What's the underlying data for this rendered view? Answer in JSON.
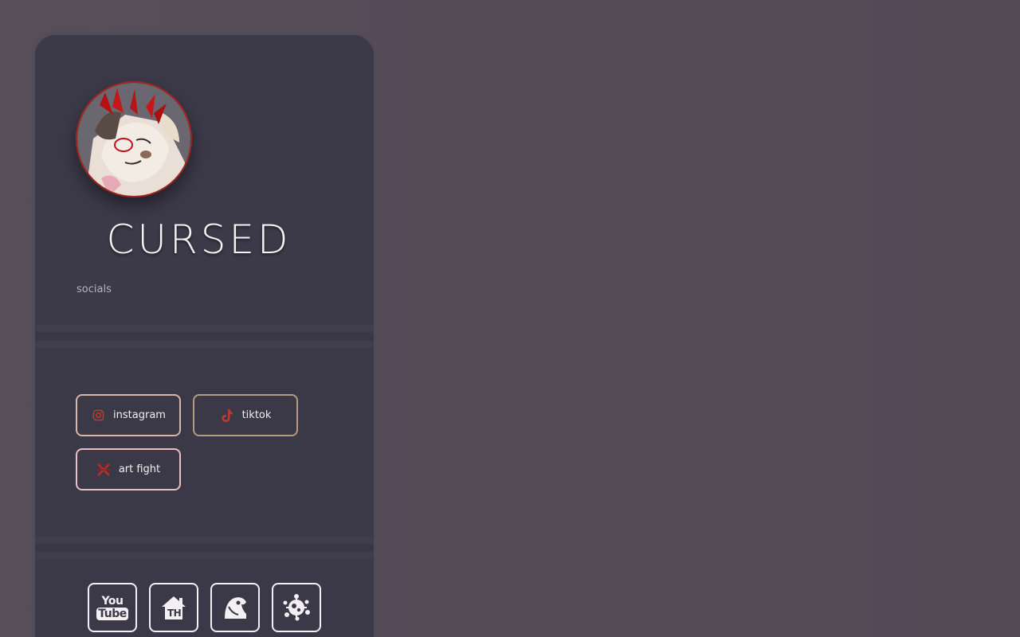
{
  "profile": {
    "name": "CURSED",
    "subtitle": "socials"
  },
  "links": [
    {
      "label": "instagram",
      "icon": "instagram-icon"
    },
    {
      "label": "tiktok",
      "icon": "tiktok-icon"
    },
    {
      "label": "art fight",
      "icon": "art-fight-icon"
    }
  ],
  "social_icons": [
    {
      "name": "youtube-icon",
      "glyph_top": "You",
      "glyph_bottom": "Tube"
    },
    {
      "name": "toyhouse-icon",
      "glyph": "TH"
    },
    {
      "name": "furaffinity-icon"
    },
    {
      "name": "splat-icon"
    }
  ],
  "colors": {
    "background": "#544c57",
    "card": "#3c3a48",
    "accent_red": "#a3261e",
    "instagram_border": "#d9b5a3",
    "tiktok_border": "#b59a84",
    "artfight_border": "#e8c0c0",
    "icon_red": "#c0392b"
  }
}
